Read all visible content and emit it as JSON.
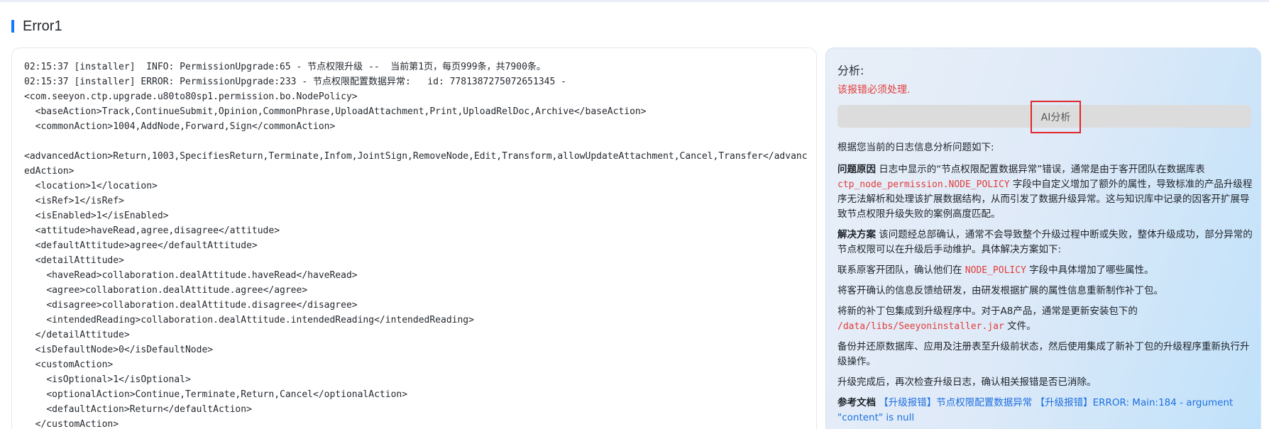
{
  "page": {
    "title": "Error1"
  },
  "log": {
    "lines": [
      "02:15:37 [installer]  INFO: PermissionUpgrade:65 - 节点权限升级 --  当前第1页，每页999条，共7900条。",
      "02:15:37 [installer] ERROR: PermissionUpgrade:233 - 节点权限配置数据异常:   id: 7781387275072651345 -",
      "<com.seeyon.ctp.upgrade.u80to80sp1.permission.bo.NodePolicy>",
      "  <baseAction>Track,ContinueSubmit,Opinion,CommonPhrase,UploadAttachment,Print,UploadRelDoc,Archive</baseAction>",
      "  <commonAction>1004,AddNode,Forward,Sign</commonAction>",
      "",
      "<advancedAction>Return,1003,SpecifiesReturn,Terminate,Infom,JointSign,RemoveNode,Edit,Transform,allowUpdateAttachment,Cancel,Transfer</advancedAction>",
      "  <location>1</location>",
      "  <isRef>1</isRef>",
      "  <isEnabled>1</isEnabled>",
      "  <attitude>haveRead,agree,disagree</attitude>",
      "  <defaultAttitude>agree</defaultAttitude>",
      "  <detailAttitude>",
      "    <haveRead>collaboration.dealAttitude.haveRead</haveRead>",
      "    <agree>collaboration.dealAttitude.agree</agree>",
      "    <disagree>collaboration.dealAttitude.disagree</disagree>",
      "    <intendedReading>collaboration.dealAttitude.intendedReading</intendedReading>",
      "  </detailAttitude>",
      "  <isDefaultNode>0</isDefaultNode>",
      "  <customAction>",
      "    <isOptional>1</isOptional>",
      "    <optionalAction>Continue,Terminate,Return,Cancel</optionalAction>",
      "    <defaultAction>Return</defaultAction>",
      "  </customAction>"
    ]
  },
  "analysis": {
    "label": "分析:",
    "warning": "该报错必须处理.",
    "ai_button": "AI分析",
    "intro": "根据您当前的日志信息分析问题如下:",
    "cause_label": "问题原因",
    "cause_text_1": " 日志中显示的“节点权限配置数据异常”错误，通常是由于客开团队在数据库表 ",
    "cause_code": "ctp_node_permission.NODE_POLICY",
    "cause_text_2": " 字段中自定义增加了额外的属性，导致标准的产品升级程序无法解析和处理该扩展数据结构，从而引发了数据升级异常。这与知识库中记录的因客开扩展导致节点权限升级失败的案例高度匹配。",
    "solution_label": "解决方案",
    "solution_text": " 该问题经总部确认，通常不会导致整个升级过程中断或失败，整体升级成功，部分异常的节点权限可以在升级后手动维护。具体解决方案如下:",
    "step1_a": "联系原客开团队，确认他们在 ",
    "step1_code": "NODE_POLICY",
    "step1_b": " 字段中具体增加了哪些属性。",
    "step2": "将客开确认的信息反馈给研发，由研发根据扩展的属性信息重新制作补丁包。",
    "step3_a": "将新的补丁包集成到升级程序中。对于A8产品，通常是更新安装包下的 ",
    "step3_code": "/data/libs/Seeyoninstaller.jar",
    "step3_b": " 文件。",
    "step4": "备份并还原数据库、应用及注册表至升级前状态，然后使用集成了新补丁包的升级程序重新执行升级操作。",
    "step5": "升级完成后，再次检查升级日志，确认相关报错是否已消除。",
    "ref_label": "参考文档",
    "ref_link_1": " 【升级报错】节点权限配置数据异常",
    "ref_link_2": " 【升级报错】ERROR: Main:184 - argument \"content\" is null"
  },
  "colors": {
    "accent": "#1677ff",
    "warning": "#e23c39",
    "link": "#1d6fe0"
  }
}
